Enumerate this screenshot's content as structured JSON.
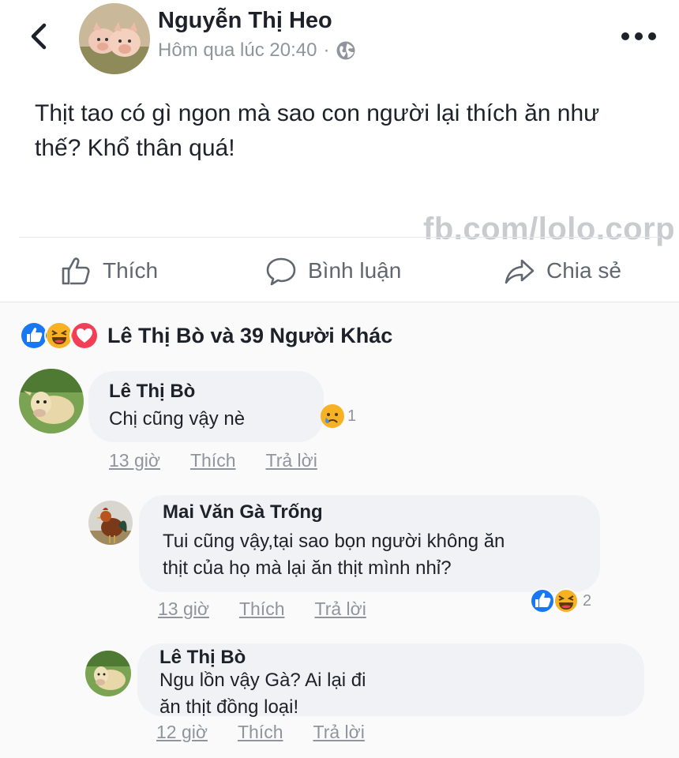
{
  "post": {
    "author": "Nguyễn Thị Heo",
    "time": "Hôm qua lúc 20:40",
    "separator": "·",
    "text": "Thịt tao có gì ngon mà sao con người lại thích ăn như thế? Khổ thân quá!",
    "watermark": "fb.com/lolo.corp"
  },
  "actions": {
    "like": "Thích",
    "comment": "Bình luận",
    "share": "Chia sẻ"
  },
  "reactions": {
    "summary": "Lê Thị Bò và 39 Người Khác",
    "icons": [
      "like-icon",
      "haha-icon",
      "love-icon"
    ]
  },
  "comments": [
    {
      "author": "Lê Thị Bò",
      "text": "Chị cũng vậy nè",
      "time": "13 giờ",
      "like": "Thích",
      "reply": "Trả lời",
      "reaction_count": "1",
      "reaction_icons": [
        "sad-icon"
      ]
    },
    {
      "author": "Mai Văn Gà Trống",
      "text": "Tui cũng vậy,tại sao bọn người không ăn thịt của họ mà lại ăn thịt mình nhỉ?",
      "time": "13 giờ",
      "like": "Thích",
      "reply": "Trả lời",
      "reaction_count": "2",
      "reaction_icons": [
        "like-icon",
        "haha-icon"
      ]
    },
    {
      "author": "Lê Thị Bò",
      "text": "Ngu lồn vậy Gà? Ai lại đi ăn thịt đồng loại!",
      "time": "12 giờ",
      "like": "Thích",
      "reply": "Trả lời"
    }
  ],
  "colors": {
    "like_blue": "#1877f2",
    "love_red": "#f33e58",
    "haha_yellow": "#f7b125",
    "meta_gray": "#90949c"
  }
}
